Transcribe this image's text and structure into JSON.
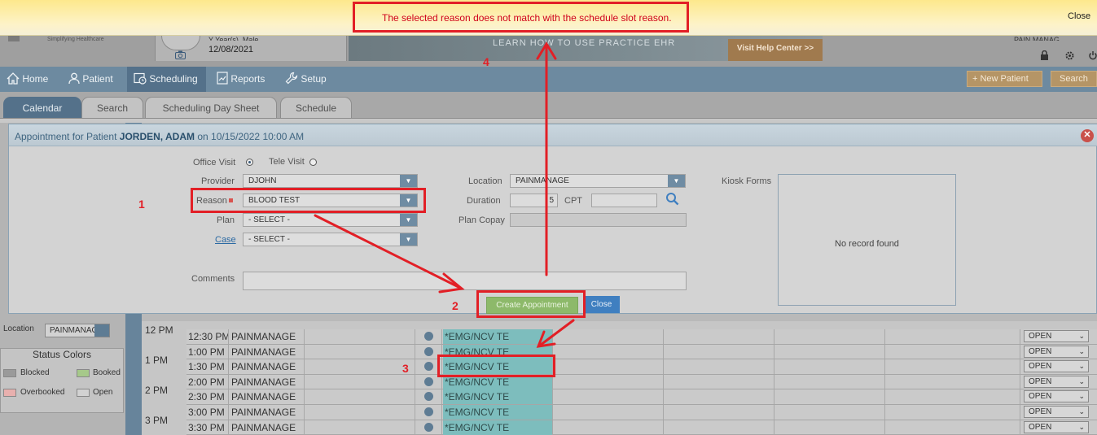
{
  "alert": {
    "message": "The selected reason does not match with the schedule slot reason.",
    "close_label": "Close"
  },
  "header": {
    "tagline": "Simplifying Healthcare",
    "patient_partial": "Y Year(s), Male",
    "date": "12/08/2021",
    "banner_text": "LEARN HOW TO USE PRACTICE EHR",
    "help_label": "Visit Help Center >>",
    "practice_partial": "PAIN MANAG..."
  },
  "nav": {
    "items": [
      {
        "label": "Home"
      },
      {
        "label": "Patient"
      },
      {
        "label": "Scheduling"
      },
      {
        "label": "Reports"
      },
      {
        "label": "Setup"
      }
    ],
    "new_patient_label": "+ New Patient",
    "search_label": "Search"
  },
  "tabs": [
    {
      "label": "Calendar"
    },
    {
      "label": "Search"
    },
    {
      "label": "Scheduling Day Sheet"
    },
    {
      "label": "Schedule"
    }
  ],
  "left_panel": {
    "location_label": "Location",
    "location_value": "PAINMANAGE",
    "status_title": "Status Colors",
    "statuses": [
      {
        "label": "Blocked",
        "color": "#9a9a9a"
      },
      {
        "label": "Booked",
        "color": "#a6c98a"
      },
      {
        "label": "Overbooked",
        "color": "#e8b0ae"
      },
      {
        "label": "Open",
        "color": "#d2d2d2"
      }
    ]
  },
  "modal": {
    "title_prefix": "Appointment for Patient",
    "patient_name": "JORDEN, ADAM",
    "title_on": "on",
    "datetime": "10/15/2022 10:00 AM",
    "office_visit_label": "Office Visit",
    "tele_visit_label": "Tele Visit",
    "provider_label": "Provider",
    "provider_value": "DJOHN",
    "reason_label": "Reason",
    "reason_value": "BLOOD TEST",
    "plan_label": "Plan",
    "plan_value": "- SELECT -",
    "case_label": "Case",
    "case_value": "- SELECT -",
    "comments_label": "Comments",
    "location_label": "Location",
    "location_value": "PAINMANAGE",
    "duration_label": "Duration",
    "duration_value": "5",
    "cpt_label": "CPT",
    "plan_copay_label": "Plan Copay",
    "kiosk_label": "Kiosk Forms",
    "kiosk_empty": "No record found",
    "create_label": "Create Appointment",
    "close_label": "Close"
  },
  "schedule": {
    "hours": [
      "12 PM",
      "1 PM",
      "2 PM",
      "3 PM"
    ],
    "rows": [
      {
        "time": "12:30 PM",
        "location": "PAINMANAGE",
        "reason": "*EMG/NCV TE",
        "status": "OPEN"
      },
      {
        "time": "1:00 PM",
        "location": "PAINMANAGE",
        "reason": "*EMG/NCV TE",
        "status": "OPEN"
      },
      {
        "time": "1:30 PM",
        "location": "PAINMANAGE",
        "reason": "*EMG/NCV TE",
        "status": "OPEN"
      },
      {
        "time": "2:00 PM",
        "location": "PAINMANAGE",
        "reason": "*EMG/NCV TE",
        "status": "OPEN"
      },
      {
        "time": "2:30 PM",
        "location": "PAINMANAGE",
        "reason": "*EMG/NCV TE",
        "status": "OPEN"
      },
      {
        "time": "3:00 PM",
        "location": "PAINMANAGE",
        "reason": "*EMG/NCV TE",
        "status": "OPEN"
      },
      {
        "time": "3:30 PM",
        "location": "PAINMANAGE",
        "reason": "*EMG/NCV TE",
        "status": "OPEN"
      }
    ]
  },
  "annotations": {
    "n1": "1",
    "n2": "2",
    "n3": "3",
    "n4": "4",
    "color": "#e21f26"
  }
}
